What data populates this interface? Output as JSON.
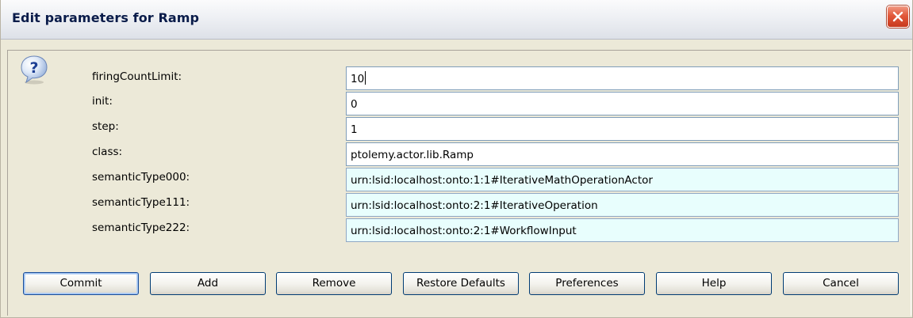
{
  "dialog": {
    "title": "Edit parameters for Ramp"
  },
  "icons": {
    "close": "close-icon",
    "question": "question-icon"
  },
  "colors": {
    "semantic_field_bg": "#e8fefd",
    "close_button": "#d9482b",
    "title_text": "#0a1c4a"
  },
  "params": [
    {
      "label": "firingCountLimit:",
      "value": "10"
    },
    {
      "label": "init:",
      "value": "0"
    },
    {
      "label": "step:",
      "value": "1"
    },
    {
      "label": "class:",
      "value": "ptolemy.actor.lib.Ramp"
    },
    {
      "label": "semanticType000:",
      "value": "urn:lsid:localhost:onto:1:1#IterativeMathOperationActor"
    },
    {
      "label": "semanticType111:",
      "value": "urn:lsid:localhost:onto:2:1#IterativeOperation"
    },
    {
      "label": "semanticType222:",
      "value": "urn:lsid:localhost:onto:2:1#WorkflowInput"
    }
  ],
  "buttons": {
    "commit": "Commit",
    "add": "Add",
    "remove": "Remove",
    "restore_defaults": "Restore Defaults",
    "preferences": "Preferences",
    "help": "Help",
    "cancel": "Cancel"
  }
}
